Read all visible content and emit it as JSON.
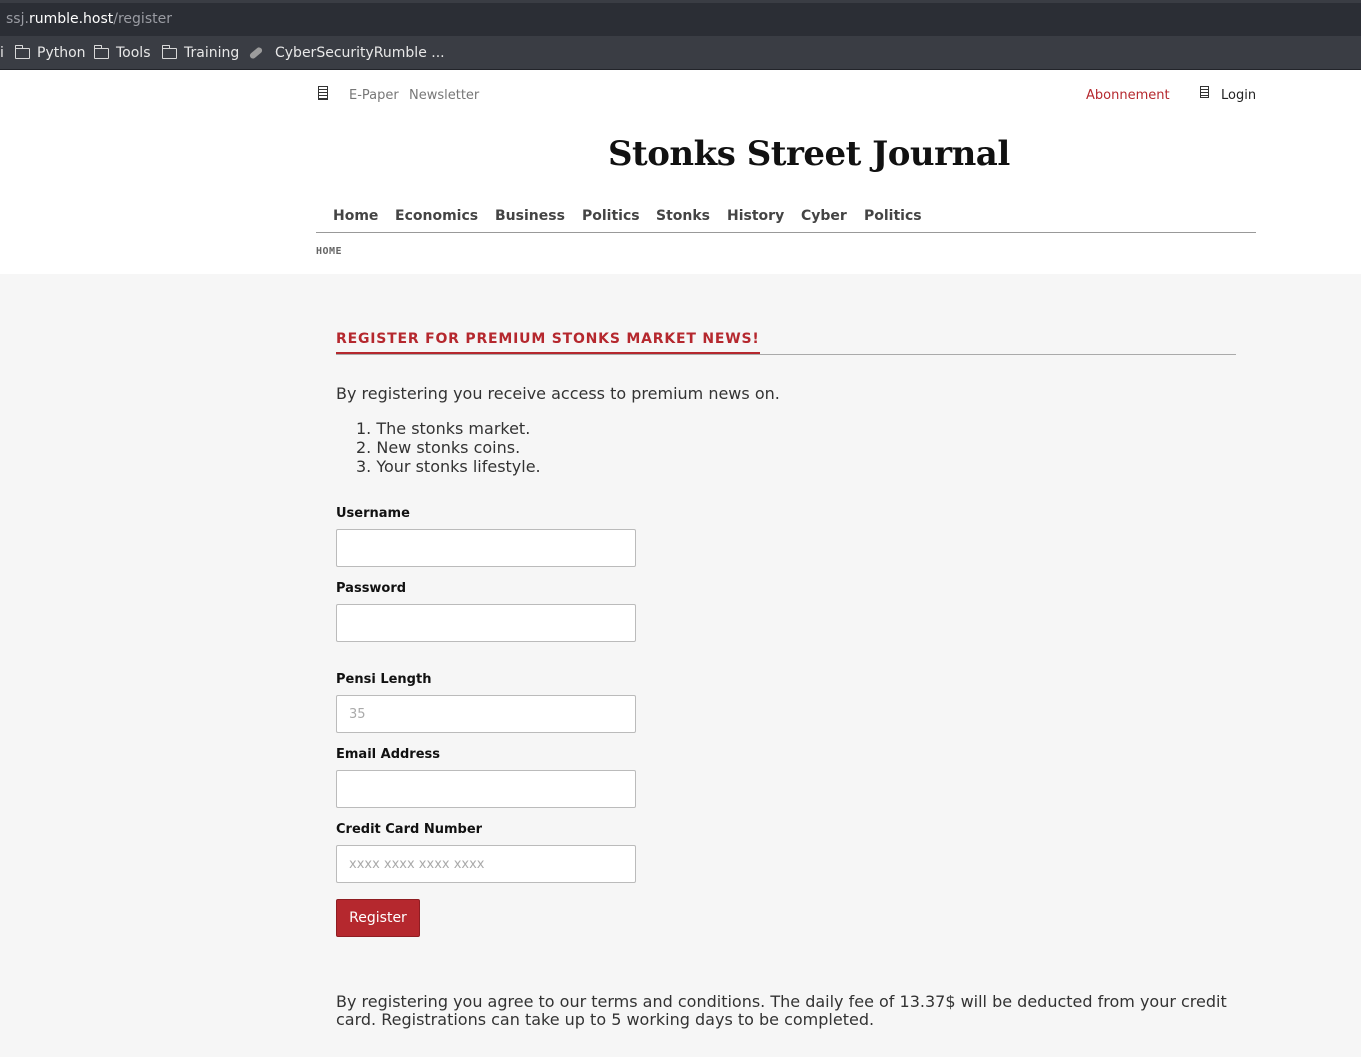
{
  "browser": {
    "url_sub": "ssj.",
    "url_host": "rumble.host",
    "url_path": "/register",
    "bookmarks": [
      {
        "label": "i",
        "icon": "truncated"
      },
      {
        "label": "Python",
        "icon": "folder-icon"
      },
      {
        "label": "Tools",
        "icon": "folder-icon"
      },
      {
        "label": "Training",
        "icon": "folder-icon"
      },
      {
        "label": "CyberSecurityRumble ...",
        "icon": "bookmark-icon"
      }
    ]
  },
  "header": {
    "top_links": [
      "E-Paper",
      "Newsletter"
    ],
    "subscription": "Abonnement",
    "login": "Login",
    "brand": "Stonks Street Journal",
    "nav": [
      "Home",
      "Economics",
      "Business",
      "Politics",
      "Stonks",
      "History",
      "Cyber",
      "Politics"
    ],
    "breadcrumb": "HOME"
  },
  "main": {
    "title": "REGISTER FOR PREMIUM STONKS MARKET NEWS!",
    "intro": "By registering you receive access to premium news on.",
    "benefits": [
      "1. The stonks market.",
      "2. New stonks coins.",
      "3. Your stonks lifestyle."
    ],
    "form": {
      "username_label": "Username",
      "username_value": "",
      "password_label": "Password",
      "password_value": "",
      "pensi_label": "Pensi Length",
      "pensi_placeholder": "35",
      "email_label": "Email Address",
      "email_value": "",
      "cc_label": "Credit Card Number",
      "cc_placeholder": "xxxx xxxx xxxx xxxx",
      "submit": "Register"
    },
    "terms": "By registering you agree to our terms and conditions. The daily fee of 13.37$ will be deducted from your credit card. Registrations can take up to 5 working days to be completed."
  },
  "colors": {
    "accent": "#b5282e",
    "page_bg": "#f6f6f6",
    "header_bg": "#ffffff",
    "chrome_dark": "#2b2e35"
  }
}
